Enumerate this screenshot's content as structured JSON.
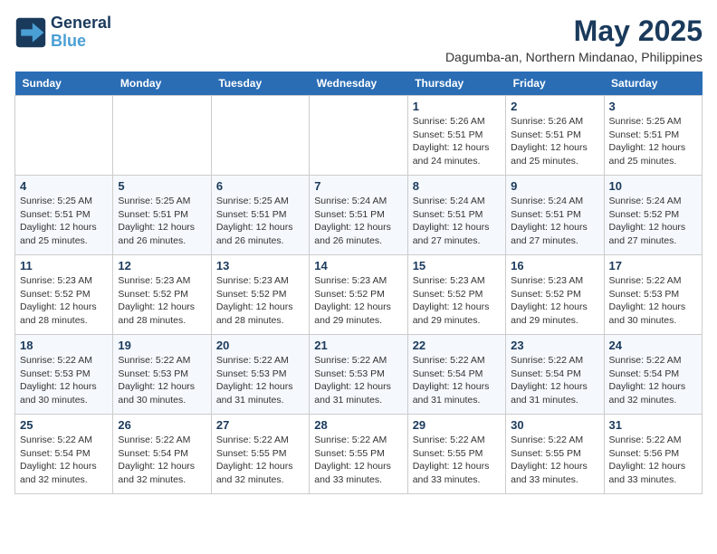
{
  "logo": {
    "text_general": "General",
    "text_blue": "Blue"
  },
  "title": "May 2025",
  "location": "Dagumba-an, Northern Mindanao, Philippines",
  "weekdays": [
    "Sunday",
    "Monday",
    "Tuesday",
    "Wednesday",
    "Thursday",
    "Friday",
    "Saturday"
  ],
  "weeks": [
    [
      {
        "day": "",
        "info": ""
      },
      {
        "day": "",
        "info": ""
      },
      {
        "day": "",
        "info": ""
      },
      {
        "day": "",
        "info": ""
      },
      {
        "day": "1",
        "info": "Sunrise: 5:26 AM\nSunset: 5:51 PM\nDaylight: 12 hours\nand 24 minutes."
      },
      {
        "day": "2",
        "info": "Sunrise: 5:26 AM\nSunset: 5:51 PM\nDaylight: 12 hours\nand 25 minutes."
      },
      {
        "day": "3",
        "info": "Sunrise: 5:25 AM\nSunset: 5:51 PM\nDaylight: 12 hours\nand 25 minutes."
      }
    ],
    [
      {
        "day": "4",
        "info": "Sunrise: 5:25 AM\nSunset: 5:51 PM\nDaylight: 12 hours\nand 25 minutes."
      },
      {
        "day": "5",
        "info": "Sunrise: 5:25 AM\nSunset: 5:51 PM\nDaylight: 12 hours\nand 26 minutes."
      },
      {
        "day": "6",
        "info": "Sunrise: 5:25 AM\nSunset: 5:51 PM\nDaylight: 12 hours\nand 26 minutes."
      },
      {
        "day": "7",
        "info": "Sunrise: 5:24 AM\nSunset: 5:51 PM\nDaylight: 12 hours\nand 26 minutes."
      },
      {
        "day": "8",
        "info": "Sunrise: 5:24 AM\nSunset: 5:51 PM\nDaylight: 12 hours\nand 27 minutes."
      },
      {
        "day": "9",
        "info": "Sunrise: 5:24 AM\nSunset: 5:51 PM\nDaylight: 12 hours\nand 27 minutes."
      },
      {
        "day": "10",
        "info": "Sunrise: 5:24 AM\nSunset: 5:52 PM\nDaylight: 12 hours\nand 27 minutes."
      }
    ],
    [
      {
        "day": "11",
        "info": "Sunrise: 5:23 AM\nSunset: 5:52 PM\nDaylight: 12 hours\nand 28 minutes."
      },
      {
        "day": "12",
        "info": "Sunrise: 5:23 AM\nSunset: 5:52 PM\nDaylight: 12 hours\nand 28 minutes."
      },
      {
        "day": "13",
        "info": "Sunrise: 5:23 AM\nSunset: 5:52 PM\nDaylight: 12 hours\nand 28 minutes."
      },
      {
        "day": "14",
        "info": "Sunrise: 5:23 AM\nSunset: 5:52 PM\nDaylight: 12 hours\nand 29 minutes."
      },
      {
        "day": "15",
        "info": "Sunrise: 5:23 AM\nSunset: 5:52 PM\nDaylight: 12 hours\nand 29 minutes."
      },
      {
        "day": "16",
        "info": "Sunrise: 5:23 AM\nSunset: 5:52 PM\nDaylight: 12 hours\nand 29 minutes."
      },
      {
        "day": "17",
        "info": "Sunrise: 5:22 AM\nSunset: 5:53 PM\nDaylight: 12 hours\nand 30 minutes."
      }
    ],
    [
      {
        "day": "18",
        "info": "Sunrise: 5:22 AM\nSunset: 5:53 PM\nDaylight: 12 hours\nand 30 minutes."
      },
      {
        "day": "19",
        "info": "Sunrise: 5:22 AM\nSunset: 5:53 PM\nDaylight: 12 hours\nand 30 minutes."
      },
      {
        "day": "20",
        "info": "Sunrise: 5:22 AM\nSunset: 5:53 PM\nDaylight: 12 hours\nand 31 minutes."
      },
      {
        "day": "21",
        "info": "Sunrise: 5:22 AM\nSunset: 5:53 PM\nDaylight: 12 hours\nand 31 minutes."
      },
      {
        "day": "22",
        "info": "Sunrise: 5:22 AM\nSunset: 5:54 PM\nDaylight: 12 hours\nand 31 minutes."
      },
      {
        "day": "23",
        "info": "Sunrise: 5:22 AM\nSunset: 5:54 PM\nDaylight: 12 hours\nand 31 minutes."
      },
      {
        "day": "24",
        "info": "Sunrise: 5:22 AM\nSunset: 5:54 PM\nDaylight: 12 hours\nand 32 minutes."
      }
    ],
    [
      {
        "day": "25",
        "info": "Sunrise: 5:22 AM\nSunset: 5:54 PM\nDaylight: 12 hours\nand 32 minutes."
      },
      {
        "day": "26",
        "info": "Sunrise: 5:22 AM\nSunset: 5:54 PM\nDaylight: 12 hours\nand 32 minutes."
      },
      {
        "day": "27",
        "info": "Sunrise: 5:22 AM\nSunset: 5:55 PM\nDaylight: 12 hours\nand 32 minutes."
      },
      {
        "day": "28",
        "info": "Sunrise: 5:22 AM\nSunset: 5:55 PM\nDaylight: 12 hours\nand 33 minutes."
      },
      {
        "day": "29",
        "info": "Sunrise: 5:22 AM\nSunset: 5:55 PM\nDaylight: 12 hours\nand 33 minutes."
      },
      {
        "day": "30",
        "info": "Sunrise: 5:22 AM\nSunset: 5:55 PM\nDaylight: 12 hours\nand 33 minutes."
      },
      {
        "day": "31",
        "info": "Sunrise: 5:22 AM\nSunset: 5:56 PM\nDaylight: 12 hours\nand 33 minutes."
      }
    ]
  ]
}
